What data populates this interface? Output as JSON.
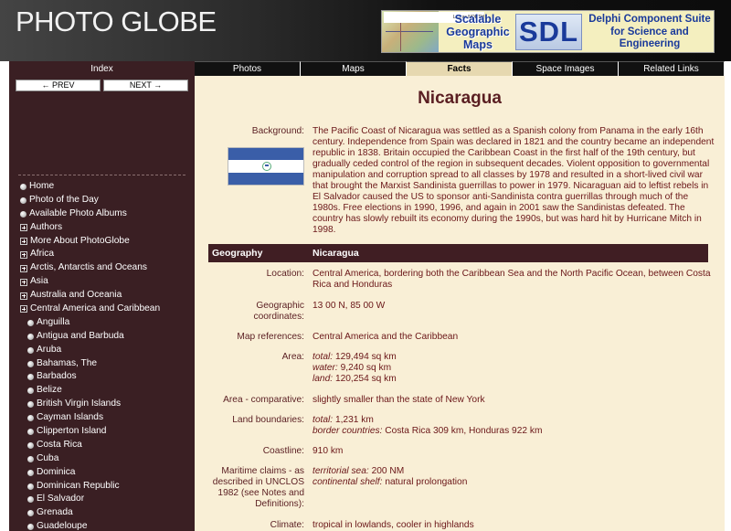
{
  "header": {
    "logo": "PHOTO GLOBE",
    "banner": {
      "map_caption": "Lomas  NORTH",
      "left_text": "Scalable Geographic Maps",
      "brand": "SDL",
      "right_text": "Delphi Component Suite for Science and Engineering"
    }
  },
  "sidebar": {
    "index_label": "Index",
    "prev_label": "← PREV",
    "next_label": "NEXT →",
    "menu": [
      {
        "label": "Home",
        "icon": "bullet-icon",
        "sub": false
      },
      {
        "label": "Photo of the Day",
        "icon": "bullet-icon",
        "sub": false
      },
      {
        "label": "Available Photo Albums",
        "icon": "bullet-icon",
        "sub": false
      },
      {
        "label": "Authors",
        "icon": "expand-icon",
        "sub": false
      },
      {
        "label": "More About PhotoGlobe",
        "icon": "expand-icon",
        "sub": false
      },
      {
        "label": "Africa",
        "icon": "expand-icon",
        "sub": false
      },
      {
        "label": "Arctis, Antarctis and Oceans",
        "icon": "expand-icon",
        "sub": false
      },
      {
        "label": "Asia",
        "icon": "expand-icon",
        "sub": false
      },
      {
        "label": "Australia and Oceania",
        "icon": "expand-icon",
        "sub": false
      },
      {
        "label": "Central America and Caribbean",
        "icon": "expand-icon",
        "sub": false
      },
      {
        "label": "Anguilla",
        "icon": "bullet-icon",
        "sub": true
      },
      {
        "label": "Antigua and Barbuda",
        "icon": "bullet-icon",
        "sub": true
      },
      {
        "label": "Aruba",
        "icon": "bullet-icon",
        "sub": true
      },
      {
        "label": "Bahamas, The",
        "icon": "bullet-icon",
        "sub": true
      },
      {
        "label": "Barbados",
        "icon": "bullet-icon",
        "sub": true
      },
      {
        "label": "Belize",
        "icon": "bullet-icon",
        "sub": true
      },
      {
        "label": "British Virgin Islands",
        "icon": "bullet-icon",
        "sub": true
      },
      {
        "label": "Cayman Islands",
        "icon": "bullet-icon",
        "sub": true
      },
      {
        "label": "Clipperton Island",
        "icon": "bullet-icon",
        "sub": true
      },
      {
        "label": "Costa Rica",
        "icon": "bullet-icon",
        "sub": true
      },
      {
        "label": "Cuba",
        "icon": "bullet-icon",
        "sub": true
      },
      {
        "label": "Dominica",
        "icon": "bullet-icon",
        "sub": true
      },
      {
        "label": "Dominican Republic",
        "icon": "bullet-icon",
        "sub": true
      },
      {
        "label": "El Salvador",
        "icon": "bullet-icon",
        "sub": true
      },
      {
        "label": "Grenada",
        "icon": "bullet-icon",
        "sub": true
      },
      {
        "label": "Guadeloupe",
        "icon": "bullet-icon",
        "sub": true
      }
    ]
  },
  "tabs": [
    {
      "label": "Photos",
      "active": false
    },
    {
      "label": "Maps",
      "active": false
    },
    {
      "label": "Facts",
      "active": true
    },
    {
      "label": "Space Images",
      "active": false
    },
    {
      "label": "Related Links",
      "active": false
    }
  ],
  "content": {
    "title": "Nicaragua",
    "background_label": "Background:",
    "background_text": "The Pacific Coast of Nicaragua was settled as a Spanish colony from Panama in the early 16th century. Independence from Spain was declared in 1821 and the country became an independent republic in 1838. Britain occupied the Caribbean Coast in the first half of the 19th century, but gradually ceded control of the region in subsequent decades. Violent opposition to governmental manipulation and corruption spread to all classes by 1978 and resulted in a short-lived civil war that brought the Marxist Sandinista guerrillas to power in 1979. Nicaraguan aid to leftist rebels in El Salvador caused the US to sponsor anti-Sandinista contra guerrillas through much of the 1980s. Free elections in 1990, 1996, and again in 2001 saw the Sandinistas defeated. The country has slowly rebuilt its economy during the 1990s, but was hard hit by Hurricane Mitch in 1998.",
    "geo_header": {
      "left": "Geography",
      "right": "Nicaragua"
    },
    "location": {
      "label": "Location:",
      "value": "Central America, bordering both the Caribbean Sea and the North Pacific Ocean, between Costa Rica and Honduras"
    },
    "coords": {
      "label": "Geographic coordinates:",
      "value": "13 00 N, 85 00 W"
    },
    "mapref": {
      "label": "Map references:",
      "value": "Central America and the Caribbean"
    },
    "area": {
      "label": "Area:",
      "total_k": "total:",
      "total": "129,494 sq km",
      "water_k": "water:",
      "water": "9,240 sq km",
      "land_k": "land:",
      "land": "120,254 sq km"
    },
    "areacomp": {
      "label": "Area - comparative:",
      "value": "slightly smaller than the state of New York"
    },
    "boundaries": {
      "label": "Land boundaries:",
      "total_k": "total:",
      "total": "1,231 km",
      "countries_k": "border countries:",
      "countries": "Costa Rica 309 km, Honduras 922 km"
    },
    "coastline": {
      "label": "Coastline:",
      "value": "910 km"
    },
    "maritime": {
      "label": "Maritime claims - as described in UNCLOS 1982 (see Notes and Definitions):",
      "sea_k": "territorial sea:",
      "sea": "200 NM",
      "shelf_k": "continental shelf:",
      "shelf": "natural prolongation"
    },
    "climate": {
      "label": "Climate:",
      "value": "tropical in lowlands, cooler in highlands"
    }
  }
}
